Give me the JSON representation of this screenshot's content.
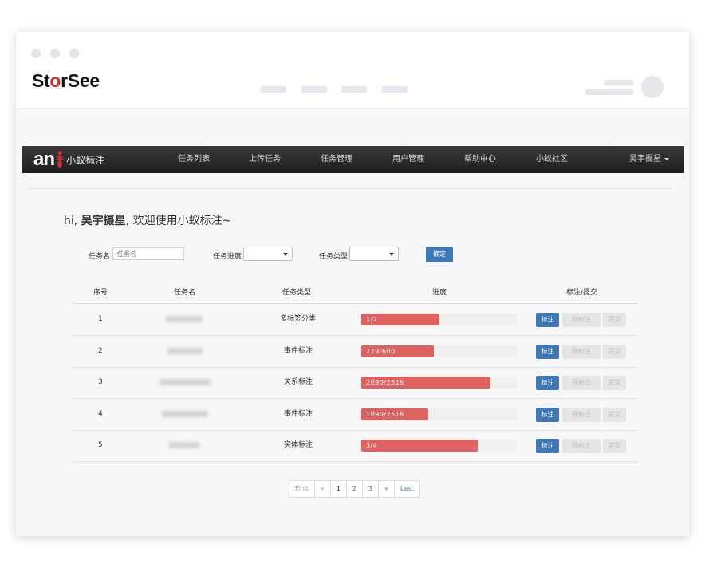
{
  "brand": {
    "logo_prefix": "St",
    "logo_o": "o",
    "logo_suffix": "rSee"
  },
  "navbar": {
    "brand_text": "an",
    "brand_name": "小蚁标注",
    "items": [
      "任务列表",
      "上传任务",
      "任务管理",
      "用户管理",
      "帮助中心",
      "小蚁社区"
    ],
    "user": "吴宇摄星"
  },
  "greeting": {
    "prefix": "hi, ",
    "user": "吴宇摄星",
    "suffix": ", 欢迎使用小蚁标注~"
  },
  "filters": {
    "name_label": "任务名",
    "name_placeholder": "任务名",
    "progress_label": "任务进度",
    "type_label": "任务类型",
    "confirm": "确定"
  },
  "table": {
    "headers": [
      "序号",
      "任务名",
      "任务类型",
      "进度",
      "标注/提交"
    ],
    "rows": [
      {
        "index": "1",
        "type": "多标签分类",
        "progress": "1/2",
        "ratio": 0.5
      },
      {
        "index": "2",
        "type": "事件标注",
        "progress": "279/600",
        "ratio": 0.465
      },
      {
        "index": "3",
        "type": "关系标注",
        "progress": "2090/2516",
        "ratio": 0.831
      },
      {
        "index": "4",
        "type": "事件标注",
        "progress": "1090/2516",
        "ratio": 0.433
      },
      {
        "index": "5",
        "type": "实体标注",
        "progress": "3/4",
        "ratio": 0.75
      }
    ],
    "actions": {
      "mark": "标注",
      "pre_mark": "预标注",
      "submit": "提交"
    }
  },
  "pagination": {
    "first": "First",
    "prev": "«",
    "pages": [
      "1",
      "2",
      "3"
    ],
    "next": "»",
    "last": "Last"
  },
  "colors": {
    "navbar": "#2a2a2a",
    "primary": "#3f79b5",
    "progress": "#df6160",
    "logo_accent": "#d0312d"
  }
}
